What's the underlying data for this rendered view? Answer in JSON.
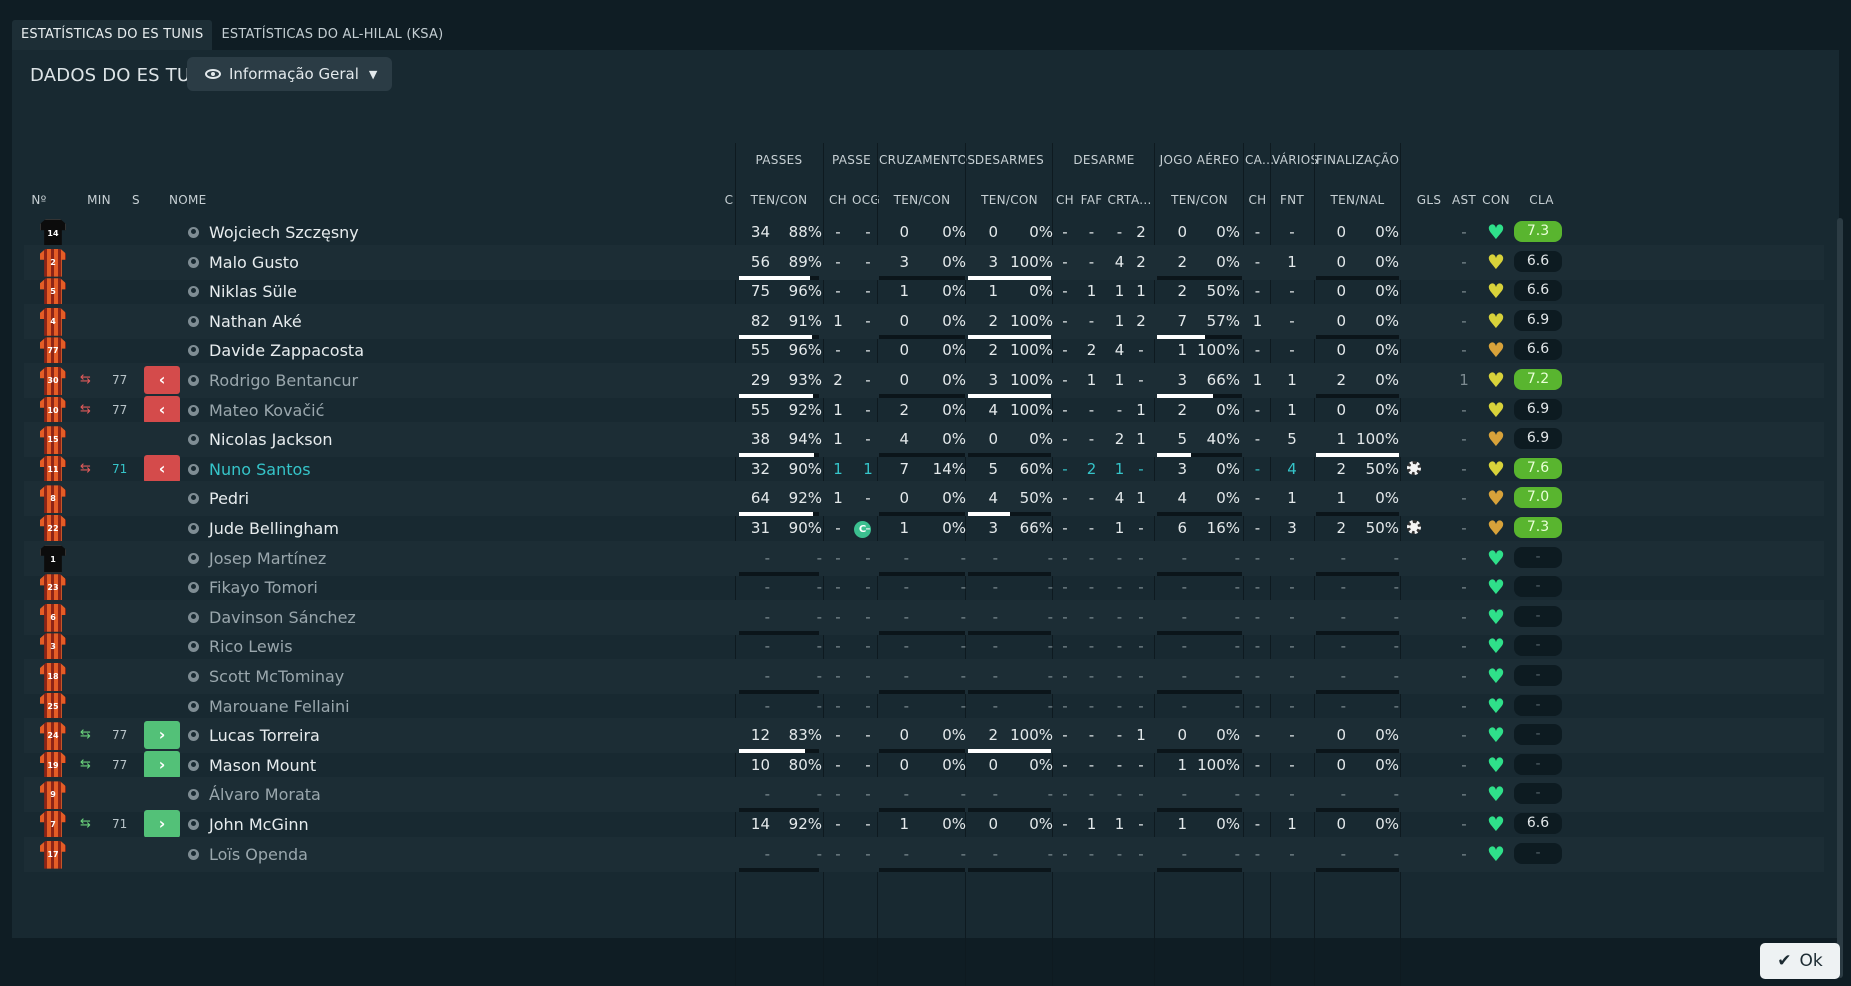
{
  "tabs": [
    "ESTATÍSTICAS DO ES TUNIS",
    "ESTATÍSTICAS DO AL-HILAL (KSA)"
  ],
  "section_title": "DADOS DO ES TUNIS",
  "view_select": "Informação Geral",
  "ok_label": "Ok",
  "groups": [
    "PASSES",
    "PASSE",
    "CRUZAMENTOS",
    "DESARMES",
    "DESARME",
    "JOGO AÉREO",
    "CA...",
    "VÁRIOS",
    "FINALIZAÇÃO"
  ],
  "columns": [
    "Nº",
    "MIN",
    "S",
    "NOME",
    "C",
    "TEN/CON",
    "CH",
    "OCG",
    "TEN/CON",
    "TEN/CON",
    "CH",
    "FAF",
    "CRT",
    "A...",
    "TEN/CON",
    "CH",
    "FNT",
    "TEN/NAL",
    "GLS",
    "AST",
    "CON",
    "CLA"
  ],
  "colors": {
    "heart_green": "#2fe08a",
    "heart_yellow": "#d8d23a",
    "heart_orange": "#d8a23a",
    "rating_green": "#59b52f"
  },
  "players": [
    {
      "num": "14",
      "kit": "black",
      "min": "",
      "sub": "",
      "name": "Wojciech Szczęsny",
      "style": "",
      "cap": "",
      "p": [
        "34",
        "88%",
        88
      ],
      "ch": "-",
      "ocg": "-",
      "cr": [
        "0",
        "0%",
        0
      ],
      "de": [
        "0",
        "0%",
        0
      ],
      "dch": "-",
      "faf": "-",
      "crt": "-",
      "a": "2",
      "air": [
        "0",
        "0%",
        0
      ],
      "cach": "-",
      "fnt": "-",
      "fin": [
        "0",
        "0%",
        0
      ],
      "gls": "",
      "ast": "-",
      "con": "green",
      "cla": "7.3",
      "cla_style": "green"
    },
    {
      "num": "2",
      "kit": "orange",
      "min": "",
      "sub": "",
      "name": "Malo Gusto",
      "style": "",
      "cap": "",
      "p": [
        "56",
        "89%",
        89
      ],
      "ch": "-",
      "ocg": "-",
      "cr": [
        "3",
        "0%",
        0
      ],
      "de": [
        "3",
        "100%",
        100
      ],
      "dch": "-",
      "faf": "-",
      "crt": "4",
      "a": "2",
      "air": [
        "2",
        "0%",
        0
      ],
      "cach": "-",
      "fnt": "1",
      "fin": [
        "0",
        "0%",
        0
      ],
      "gls": "",
      "ast": "-",
      "con": "yellow",
      "cla": "6.6",
      "cla_style": ""
    },
    {
      "num": "5",
      "kit": "orange",
      "min": "",
      "sub": "",
      "name": "Niklas Süle",
      "style": "",
      "cap": "",
      "p": [
        "75",
        "96%",
        96
      ],
      "ch": "-",
      "ocg": "-",
      "cr": [
        "1",
        "0%",
        0
      ],
      "de": [
        "1",
        "0%",
        0
      ],
      "dch": "-",
      "faf": "1",
      "crt": "1",
      "a": "1",
      "air": [
        "2",
        "50%",
        50
      ],
      "cach": "-",
      "fnt": "-",
      "fin": [
        "0",
        "0%",
        0
      ],
      "gls": "",
      "ast": "-",
      "con": "yellow",
      "cla": "6.6",
      "cla_style": ""
    },
    {
      "num": "4",
      "kit": "orange",
      "min": "",
      "sub": "",
      "name": "Nathan Aké",
      "style": "",
      "cap": "",
      "p": [
        "82",
        "91%",
        91
      ],
      "ch": "1",
      "ocg": "-",
      "cr": [
        "0",
        "0%",
        0
      ],
      "de": [
        "2",
        "100%",
        100
      ],
      "dch": "-",
      "faf": "-",
      "crt": "1",
      "a": "2",
      "air": [
        "7",
        "57%",
        57
      ],
      "cach": "1",
      "fnt": "-",
      "fin": [
        "0",
        "0%",
        0
      ],
      "gls": "",
      "ast": "-",
      "con": "yellow",
      "cla": "6.9",
      "cla_style": ""
    },
    {
      "num": "77",
      "kit": "orange",
      "min": "",
      "sub": "",
      "name": "Davide Zappacosta",
      "style": "",
      "cap": "",
      "p": [
        "55",
        "96%",
        96
      ],
      "ch": "-",
      "ocg": "-",
      "cr": [
        "0",
        "0%",
        0
      ],
      "de": [
        "2",
        "100%",
        100
      ],
      "dch": "-",
      "faf": "2",
      "crt": "4",
      "a": "-",
      "air": [
        "1",
        "100%",
        100
      ],
      "cach": "-",
      "fnt": "-",
      "fin": [
        "0",
        "0%",
        0
      ],
      "gls": "",
      "ast": "-",
      "con": "orange",
      "cla": "6.6",
      "cla_style": ""
    },
    {
      "num": "30",
      "kit": "orange",
      "min": "77",
      "sub": "out",
      "name": "Rodrigo Bentancur",
      "style": "dim",
      "cap": "",
      "p": [
        "29",
        "93%",
        93
      ],
      "ch": "2",
      "ocg": "-",
      "cr": [
        "0",
        "0%",
        0
      ],
      "de": [
        "3",
        "100%",
        100
      ],
      "dch": "-",
      "faf": "1",
      "crt": "1",
      "a": "-",
      "air": [
        "3",
        "66%",
        66
      ],
      "cach": "1",
      "fnt": "1",
      "fin": [
        "2",
        "0%",
        0
      ],
      "gls": "",
      "ast": "1",
      "con": "yellow",
      "cla": "7.2",
      "cla_style": "green"
    },
    {
      "num": "10",
      "kit": "orange",
      "min": "77",
      "sub": "out",
      "name": "Mateo Kovačić",
      "style": "dim",
      "cap": "",
      "p": [
        "55",
        "92%",
        92
      ],
      "ch": "1",
      "ocg": "-",
      "cr": [
        "2",
        "0%",
        0
      ],
      "de": [
        "4",
        "100%",
        100
      ],
      "dch": "-",
      "faf": "-",
      "crt": "-",
      "a": "1",
      "air": [
        "2",
        "0%",
        0
      ],
      "cach": "-",
      "fnt": "1",
      "fin": [
        "0",
        "0%",
        0
      ],
      "gls": "",
      "ast": "-",
      "con": "yellow",
      "cla": "6.9",
      "cla_style": ""
    },
    {
      "num": "15",
      "kit": "orange",
      "min": "",
      "sub": "",
      "name": "Nicolas Jackson",
      "style": "",
      "cap": "",
      "p": [
        "38",
        "94%",
        94
      ],
      "ch": "1",
      "ocg": "-",
      "cr": [
        "4",
        "0%",
        0
      ],
      "de": [
        "0",
        "0%",
        0
      ],
      "dch": "-",
      "faf": "-",
      "crt": "2",
      "a": "1",
      "air": [
        "5",
        "40%",
        40
      ],
      "cach": "-",
      "fnt": "5",
      "fin": [
        "1",
        "100%",
        100
      ],
      "gls": "",
      "ast": "-",
      "con": "orange",
      "cla": "6.9",
      "cla_style": ""
    },
    {
      "num": "11",
      "kit": "orange",
      "min": "71",
      "sub": "out",
      "name": "Nuno Santos",
      "style": "teal",
      "cap": "",
      "p": [
        "32",
        "90%",
        90
      ],
      "ch": "1",
      "ocg": "1",
      "cr": [
        "7",
        "14%",
        14
      ],
      "de": [
        "5",
        "60%",
        60
      ],
      "dch": "-",
      "faf": "2",
      "crt": "1",
      "a": "-",
      "air": [
        "3",
        "0%",
        0
      ],
      "cach": "-",
      "fnt": "4",
      "fin": [
        "2",
        "50%",
        50
      ],
      "gls": "ball",
      "ast": "-",
      "con": "yellow",
      "cla": "7.6",
      "cla_style": "green"
    },
    {
      "num": "8",
      "kit": "orange",
      "min": "",
      "sub": "",
      "name": "Pedri",
      "style": "",
      "cap": "",
      "p": [
        "64",
        "92%",
        92
      ],
      "ch": "1",
      "ocg": "-",
      "cr": [
        "0",
        "0%",
        0
      ],
      "de": [
        "4",
        "50%",
        50
      ],
      "dch": "-",
      "faf": "-",
      "crt": "4",
      "a": "1",
      "air": [
        "4",
        "0%",
        0
      ],
      "cach": "-",
      "fnt": "1",
      "fin": [
        "1",
        "0%",
        0
      ],
      "gls": "",
      "ast": "-",
      "con": "orange",
      "cla": "7.0",
      "cla_style": "green"
    },
    {
      "num": "22",
      "kit": "orange",
      "min": "",
      "sub": "",
      "name": "Jude Bellingham",
      "style": "",
      "cap": "C",
      "p": [
        "31",
        "90%",
        90
      ],
      "ch": "-",
      "ocg": "-",
      "cr": [
        "1",
        "0%",
        0
      ],
      "de": [
        "3",
        "66%",
        66
      ],
      "dch": "-",
      "faf": "-",
      "crt": "1",
      "a": "-",
      "air": [
        "6",
        "16%",
        16
      ],
      "cach": "-",
      "fnt": "3",
      "fin": [
        "2",
        "50%",
        50
      ],
      "gls": "ball",
      "ast": "-",
      "con": "orange",
      "cla": "7.3",
      "cla_style": "green"
    },
    {
      "num": "1",
      "kit": "black",
      "min": "",
      "sub": "",
      "name": "Josep Martínez",
      "style": "dim",
      "cap": "",
      "p": [
        "-",
        "-",
        0
      ],
      "ch": "-",
      "ocg": "-",
      "cr": [
        "-",
        "-",
        0
      ],
      "de": [
        "-",
        "-",
        0
      ],
      "dch": "-",
      "faf": "-",
      "crt": "-",
      "a": "-",
      "air": [
        "-",
        "-",
        0
      ],
      "cach": "-",
      "fnt": "-",
      "fin": [
        "-",
        "-",
        0
      ],
      "gls": "",
      "ast": "-",
      "con": "green",
      "cla": "-",
      "cla_style": "empty"
    },
    {
      "num": "23",
      "kit": "orange",
      "min": "",
      "sub": "",
      "name": "Fikayo Tomori",
      "style": "dim",
      "cap": "",
      "p": [
        "-",
        "-",
        0
      ],
      "ch": "-",
      "ocg": "-",
      "cr": [
        "-",
        "-",
        0
      ],
      "de": [
        "-",
        "-",
        0
      ],
      "dch": "-",
      "faf": "-",
      "crt": "-",
      "a": "-",
      "air": [
        "-",
        "-",
        0
      ],
      "cach": "-",
      "fnt": "-",
      "fin": [
        "-",
        "-",
        0
      ],
      "gls": "",
      "ast": "-",
      "con": "green",
      "cla": "-",
      "cla_style": "empty"
    },
    {
      "num": "6",
      "kit": "orange",
      "min": "",
      "sub": "",
      "name": "Davinson Sánchez",
      "style": "dim",
      "cap": "",
      "p": [
        "-",
        "-",
        0
      ],
      "ch": "-",
      "ocg": "-",
      "cr": [
        "-",
        "-",
        0
      ],
      "de": [
        "-",
        "-",
        0
      ],
      "dch": "-",
      "faf": "-",
      "crt": "-",
      "a": "-",
      "air": [
        "-",
        "-",
        0
      ],
      "cach": "-",
      "fnt": "-",
      "fin": [
        "-",
        "-",
        0
      ],
      "gls": "",
      "ast": "-",
      "con": "green",
      "cla": "-",
      "cla_style": "empty"
    },
    {
      "num": "3",
      "kit": "orange",
      "min": "",
      "sub": "",
      "name": "Rico Lewis",
      "style": "dim",
      "cap": "",
      "p": [
        "-",
        "-",
        0
      ],
      "ch": "-",
      "ocg": "-",
      "cr": [
        "-",
        "-",
        0
      ],
      "de": [
        "-",
        "-",
        0
      ],
      "dch": "-",
      "faf": "-",
      "crt": "-",
      "a": "-",
      "air": [
        "-",
        "-",
        0
      ],
      "cach": "-",
      "fnt": "-",
      "fin": [
        "-",
        "-",
        0
      ],
      "gls": "",
      "ast": "-",
      "con": "green",
      "cla": "-",
      "cla_style": "empty"
    },
    {
      "num": "18",
      "kit": "orange",
      "min": "",
      "sub": "",
      "name": "Scott McTominay",
      "style": "dim",
      "cap": "",
      "p": [
        "-",
        "-",
        0
      ],
      "ch": "-",
      "ocg": "-",
      "cr": [
        "-",
        "-",
        0
      ],
      "de": [
        "-",
        "-",
        0
      ],
      "dch": "-",
      "faf": "-",
      "crt": "-",
      "a": "-",
      "air": [
        "-",
        "-",
        0
      ],
      "cach": "-",
      "fnt": "-",
      "fin": [
        "-",
        "-",
        0
      ],
      "gls": "",
      "ast": "-",
      "con": "green",
      "cla": "-",
      "cla_style": "empty"
    },
    {
      "num": "25",
      "kit": "orange",
      "min": "",
      "sub": "",
      "name": "Marouane Fellaini",
      "style": "dim",
      "cap": "",
      "p": [
        "-",
        "-",
        0
      ],
      "ch": "-",
      "ocg": "-",
      "cr": [
        "-",
        "-",
        0
      ],
      "de": [
        "-",
        "-",
        0
      ],
      "dch": "-",
      "faf": "-",
      "crt": "-",
      "a": "-",
      "air": [
        "-",
        "-",
        0
      ],
      "cach": "-",
      "fnt": "-",
      "fin": [
        "-",
        "-",
        0
      ],
      "gls": "",
      "ast": "-",
      "con": "green",
      "cla": "-",
      "cla_style": "empty"
    },
    {
      "num": "24",
      "kit": "orange",
      "min": "77",
      "sub": "in",
      "name": "Lucas Torreira",
      "style": "",
      "cap": "",
      "p": [
        "12",
        "83%",
        83
      ],
      "ch": "-",
      "ocg": "-",
      "cr": [
        "0",
        "0%",
        0
      ],
      "de": [
        "2",
        "100%",
        100
      ],
      "dch": "-",
      "faf": "-",
      "crt": "-",
      "a": "1",
      "air": [
        "0",
        "0%",
        0
      ],
      "cach": "-",
      "fnt": "-",
      "fin": [
        "0",
        "0%",
        0
      ],
      "gls": "",
      "ast": "-",
      "con": "green",
      "cla": "-",
      "cla_style": "empty"
    },
    {
      "num": "19",
      "kit": "orange",
      "min": "77",
      "sub": "in",
      "name": "Mason Mount",
      "style": "",
      "cap": "",
      "p": [
        "10",
        "80%",
        80
      ],
      "ch": "-",
      "ocg": "-",
      "cr": [
        "0",
        "0%",
        0
      ],
      "de": [
        "0",
        "0%",
        0
      ],
      "dch": "-",
      "faf": "-",
      "crt": "-",
      "a": "-",
      "air": [
        "1",
        "100%",
        100
      ],
      "cach": "-",
      "fnt": "-",
      "fin": [
        "0",
        "0%",
        0
      ],
      "gls": "",
      "ast": "-",
      "con": "green",
      "cla": "-",
      "cla_style": "empty"
    },
    {
      "num": "9",
      "kit": "orange",
      "min": "",
      "sub": "",
      "name": "Álvaro Morata",
      "style": "dim",
      "cap": "",
      "p": [
        "-",
        "-",
        0
      ],
      "ch": "-",
      "ocg": "-",
      "cr": [
        "-",
        "-",
        0
      ],
      "de": [
        "-",
        "-",
        0
      ],
      "dch": "-",
      "faf": "-",
      "crt": "-",
      "a": "-",
      "air": [
        "-",
        "-",
        0
      ],
      "cach": "-",
      "fnt": "-",
      "fin": [
        "-",
        "-",
        0
      ],
      "gls": "",
      "ast": "-",
      "con": "green",
      "cla": "-",
      "cla_style": "empty"
    },
    {
      "num": "7",
      "kit": "orange",
      "min": "71",
      "sub": "in",
      "name": "John McGinn",
      "style": "",
      "cap": "",
      "p": [
        "14",
        "92%",
        92
      ],
      "ch": "-",
      "ocg": "-",
      "cr": [
        "1",
        "0%",
        0
      ],
      "de": [
        "0",
        "0%",
        0
      ],
      "dch": "-",
      "faf": "1",
      "crt": "1",
      "a": "-",
      "air": [
        "1",
        "0%",
        0
      ],
      "cach": "-",
      "fnt": "1",
      "fin": [
        "0",
        "0%",
        0
      ],
      "gls": "",
      "ast": "-",
      "con": "green",
      "cla": "6.6",
      "cla_style": ""
    },
    {
      "num": "17",
      "kit": "orange",
      "min": "",
      "sub": "",
      "name": "Loïs Openda",
      "style": "dim",
      "cap": "",
      "p": [
        "-",
        "-",
        0
      ],
      "ch": "-",
      "ocg": "-",
      "cr": [
        "-",
        "-",
        0
      ],
      "de": [
        "-",
        "-",
        0
      ],
      "dch": "-",
      "faf": "-",
      "crt": "-",
      "a": "-",
      "air": [
        "-",
        "-",
        0
      ],
      "cach": "-",
      "fnt": "-",
      "fin": [
        "-",
        "-",
        0
      ],
      "gls": "",
      "ast": "-",
      "con": "green",
      "cla": "-",
      "cla_style": "empty"
    }
  ]
}
